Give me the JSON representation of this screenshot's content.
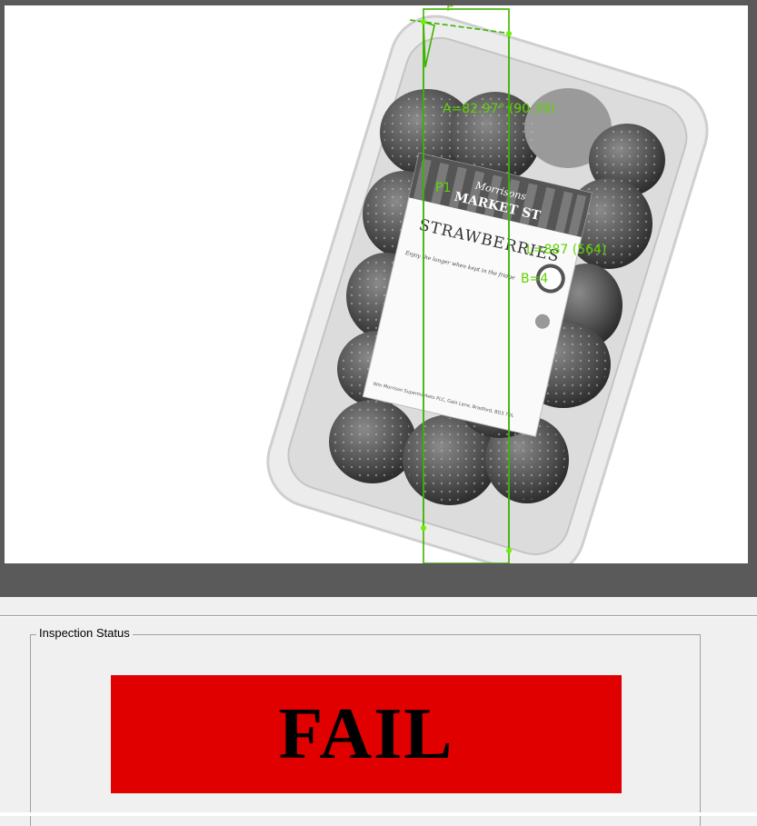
{
  "viewer": {
    "measurements": {
      "angle_label": "A=82.97° (90.39)",
      "length_label": "L=887 (564)",
      "count_label": "B=4",
      "point_label": "P1",
      "top_label": "P"
    },
    "overlay_color": "#5fd400"
  },
  "product_label": {
    "brand": "Morrisons",
    "sub_brand": "MARKET ST",
    "product_name": "STRAWBERRIES",
    "note_line": "Enjoy the longer when kept in the fridge",
    "footer": "Wm Morrison Supermarkets PLC, Gain Lane, Bradford, BD3 7DL"
  },
  "status_panel": {
    "group_title": "Inspection Status",
    "result": "FAIL",
    "result_color": "#e00000"
  }
}
